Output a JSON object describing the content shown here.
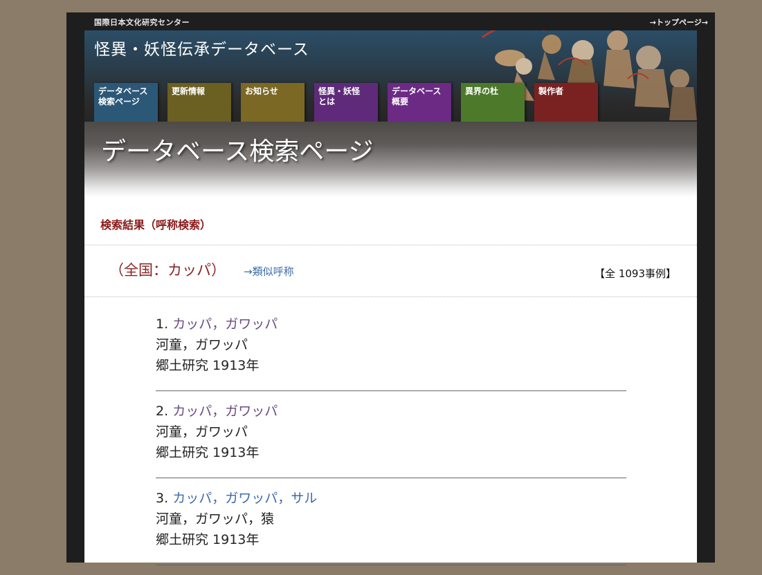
{
  "header": {
    "org_name": "国際日本文化研究センター",
    "top_link": "→トップページ→",
    "site_title": "怪異・妖怪伝承データベース"
  },
  "nav": {
    "tabs": [
      {
        "line1": "データベース",
        "line2": "検索ページ",
        "color": "#2c5878"
      },
      {
        "line1": "更新情報",
        "line2": "",
        "color": "#6b5f22"
      },
      {
        "line1": "お知らせ",
        "line2": "",
        "color": "#7b6824"
      },
      {
        "line1": "怪異・妖怪",
        "line2": "とは",
        "color": "#5f2a7a"
      },
      {
        "line1": "データベース",
        "line2": "概要",
        "color": "#6c2a85"
      },
      {
        "line1": "異界の杜",
        "line2": "",
        "color": "#4d7a2a"
      },
      {
        "line1": "製作者",
        "line2": "",
        "color": "#7a2222"
      }
    ]
  },
  "hero": {
    "title": "データベース検索ページ"
  },
  "search": {
    "heading": "検索結果（呼称検索）",
    "query": "（全国：カッパ）",
    "similar_link": "→類似呼称",
    "total": "【全 1093事例】"
  },
  "results": [
    {
      "number": "1.",
      "title": "カッパ，ガワッパ",
      "names": "河童，ガワッパ",
      "source": "郷土研究 1913年",
      "link_color": "#6a4a82"
    },
    {
      "number": "2.",
      "title": "カッパ，ガワッパ",
      "names": "河童，ガワッパ",
      "source": "郷土研究 1913年",
      "link_color": "#6a4a82"
    },
    {
      "number": "3.",
      "title": "カッパ，ガワッパ，サル",
      "names": "河童，ガワッパ，猿",
      "source": "郷土研究 1913年",
      "link_color": "#3d6aa8"
    }
  ]
}
